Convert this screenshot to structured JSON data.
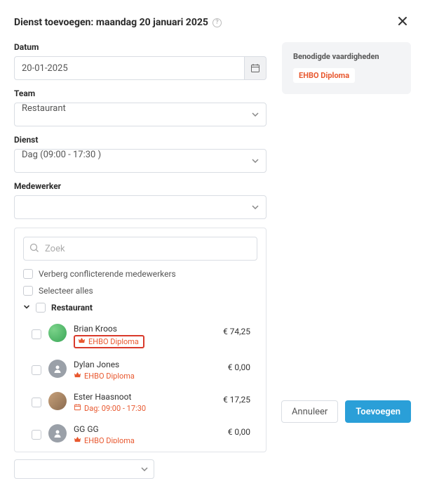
{
  "modal": {
    "title": "Dienst toevoegen: maandag 20 januari 2025"
  },
  "fields": {
    "date_label": "Datum",
    "date_value": "20-01-2025",
    "team_label": "Team",
    "team_value": "Restaurant",
    "shift_label": "Dienst",
    "shift_value": "Dag (09:00 - 17:30 )",
    "employee_label": "Medewerker"
  },
  "skills": {
    "title": "Benodigde vaardigheden",
    "tag": "EHBO Diploma"
  },
  "panel": {
    "search_placeholder": "Zoek",
    "hide_conflicts": "Verberg conflicterende medewerkers",
    "select_all": "Selecteer alles",
    "group_name": "Restaurant"
  },
  "employees": [
    {
      "name": "Brian Kroos",
      "skill": "EHBO Diploma",
      "shift": "",
      "cost": "€ 74,25",
      "highlight": true,
      "avatar": "green"
    },
    {
      "name": "Dylan Jones",
      "skill": "EHBO Diploma",
      "shift": "",
      "cost": "€ 0,00",
      "highlight": false,
      "avatar": "gray"
    },
    {
      "name": "Ester Haasnoot",
      "skill": "",
      "shift": "Dag: 09:00 - 17:30",
      "cost": "€ 17,25",
      "highlight": false,
      "avatar": "photo1"
    },
    {
      "name": "GG GG",
      "skill": "EHBO Diploma",
      "shift": "",
      "cost": "€ 0,00",
      "highlight": false,
      "avatar": "gray"
    }
  ],
  "footer": {
    "cancel": "Annuleer",
    "submit": "Toevoegen"
  }
}
